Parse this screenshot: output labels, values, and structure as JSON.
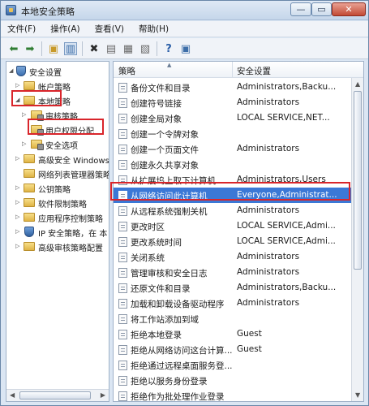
{
  "window": {
    "title": "本地安全策略"
  },
  "titlebar_buttons": {
    "minimize": "—",
    "maximize": "▭",
    "close": "✕"
  },
  "menu": [
    "文件(F)",
    "操作(A)",
    "查看(V)",
    "帮助(H)"
  ],
  "toolbar_icons": [
    "back-arrow-icon",
    "forward-arrow-icon",
    "up-folder-icon",
    "show-tree-icon",
    "delete-icon",
    "properties-icon",
    "refresh-icon",
    "export-list-icon",
    "help-icon",
    "console-icon"
  ],
  "tree": {
    "root": "安全设置",
    "items": [
      {
        "label": "帐户策略"
      },
      {
        "label": "本地策略",
        "highlighted": true
      },
      {
        "label": "审核策略"
      },
      {
        "label": "用户权限分配",
        "highlighted": true
      },
      {
        "label": "安全选项"
      },
      {
        "label": "高级安全 Windows"
      },
      {
        "label": "网络列表管理器策略"
      },
      {
        "label": "公钥策略"
      },
      {
        "label": "软件限制策略"
      },
      {
        "label": "应用程序控制策略"
      },
      {
        "label": "IP 安全策略，在 本"
      },
      {
        "label": "高级审核策略配置"
      }
    ]
  },
  "list": {
    "columns": [
      "策略",
      "安全设置"
    ],
    "rows": [
      {
        "name": "备份文件和目录",
        "setting": "Administrators,Backu..."
      },
      {
        "name": "创建符号链接",
        "setting": "Administrators"
      },
      {
        "name": "创建全局对象",
        "setting": "LOCAL SERVICE,NET..."
      },
      {
        "name": "创建一个令牌对象",
        "setting": ""
      },
      {
        "name": "创建一个页面文件",
        "setting": "Administrators"
      },
      {
        "name": "创建永久共享对象",
        "setting": ""
      },
      {
        "name": "从扩展坞上取下计算机",
        "setting": "Administrators,Users"
      },
      {
        "name": "从网络访问此计算机",
        "setting": "Everyone,Administrat...",
        "selected": true
      },
      {
        "name": "从远程系统强制关机",
        "setting": "Administrators"
      },
      {
        "name": "更改时区",
        "setting": "LOCAL SERVICE,Admi..."
      },
      {
        "name": "更改系统时间",
        "setting": "LOCAL SERVICE,Admi..."
      },
      {
        "name": "关闭系统",
        "setting": "Administrators"
      },
      {
        "name": "管理审核和安全日志",
        "setting": "Administrators"
      },
      {
        "name": "还原文件和目录",
        "setting": "Administrators,Backu..."
      },
      {
        "name": "加载和卸载设备驱动程序",
        "setting": "Administrators"
      },
      {
        "name": "将工作站添加到域",
        "setting": ""
      },
      {
        "name": "拒绝本地登录",
        "setting": "Guest"
      },
      {
        "name": "拒绝从网络访问这台计算...",
        "setting": "Guest"
      },
      {
        "name": "拒绝通过远程桌面服务登...",
        "setting": ""
      },
      {
        "name": "拒绝以服务身份登录",
        "setting": ""
      },
      {
        "name": "拒绝作为批处理作业登录",
        "setting": ""
      }
    ]
  },
  "colors": {
    "selection": "#3b78d6",
    "highlight_box": "#d9252b"
  }
}
